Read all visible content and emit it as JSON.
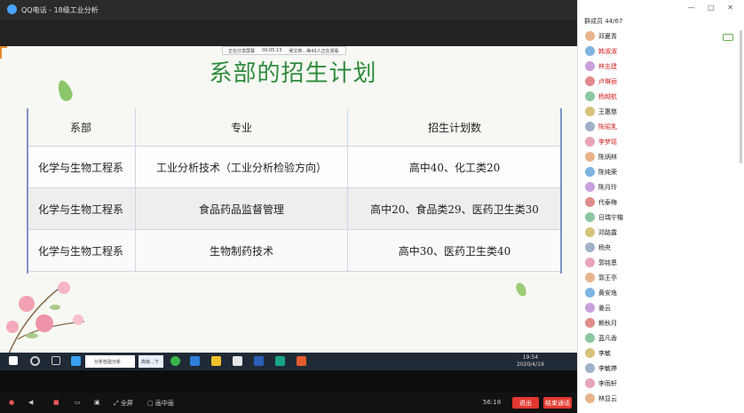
{
  "window": {
    "title": "QQ电话 - 18级工业分析"
  },
  "share_banner": {
    "status": "正在分享屏幕",
    "duration": "00:05:13",
    "notice": "吴文婷...等43人正在观看"
  },
  "slide": {
    "title": "系部的招生计划",
    "table": {
      "headers": [
        "系部",
        "专业",
        "招生计划数"
      ],
      "rows": [
        [
          "化学与生物工程系",
          "工业分析技术（工业分析检验方向）",
          "高中40、化工类20"
        ],
        [
          "化学与生物工程系",
          "食品药品监督管理",
          "高中20、食品类29、医药卫生类30"
        ],
        [
          "化学与生物工程系",
          "生物制药技术",
          "高中30、医药卫生类40"
        ]
      ]
    }
  },
  "win_taskbar": {
    "search_text": "分析检验分析",
    "search2_text": "高级...下",
    "time": "19:54",
    "date": "2020/4/19"
  },
  "bottom_bar": {
    "fullscreen": "全屏",
    "pip": "画中画",
    "duration": "56:18",
    "exit": "退出",
    "end_call": "结束通话"
  },
  "right_panel": {
    "member_count": "群成员 44/67",
    "members": [
      {
        "name": "邓夏青",
        "style": "normal"
      },
      {
        "name": "韩淑淑",
        "style": "red"
      },
      {
        "name": "林志建",
        "style": "red"
      },
      {
        "name": "卢琳丽",
        "style": "red"
      },
      {
        "name": "杨越航",
        "style": "red"
      },
      {
        "name": "王惠慈",
        "style": "normal"
      },
      {
        "name": "陈昭乳",
        "style": "red"
      },
      {
        "name": "李梦瑶",
        "style": "red"
      },
      {
        "name": "陈炳林",
        "style": "normal"
      },
      {
        "name": "陈纯荣",
        "style": "normal"
      },
      {
        "name": "陈月玲",
        "style": "normal"
      },
      {
        "name": "代泰梅",
        "style": "normal"
      },
      {
        "name": "日瑞宁楷",
        "style": "normal"
      },
      {
        "name": "邓路露",
        "style": "normal"
      },
      {
        "name": "杨央",
        "style": "normal"
      },
      {
        "name": "郭铭恩",
        "style": "normal"
      },
      {
        "name": "郭王亭",
        "style": "normal"
      },
      {
        "name": "黄安逸",
        "style": "normal"
      },
      {
        "name": "姜云",
        "style": "normal"
      },
      {
        "name": "赖秋月",
        "style": "normal"
      },
      {
        "name": "蓝凡香",
        "style": "normal"
      },
      {
        "name": "李敏",
        "style": "normal"
      },
      {
        "name": "李敏婷",
        "style": "normal"
      },
      {
        "name": "李雨轩",
        "style": "normal"
      },
      {
        "name": "林显云",
        "style": "normal"
      }
    ]
  }
}
